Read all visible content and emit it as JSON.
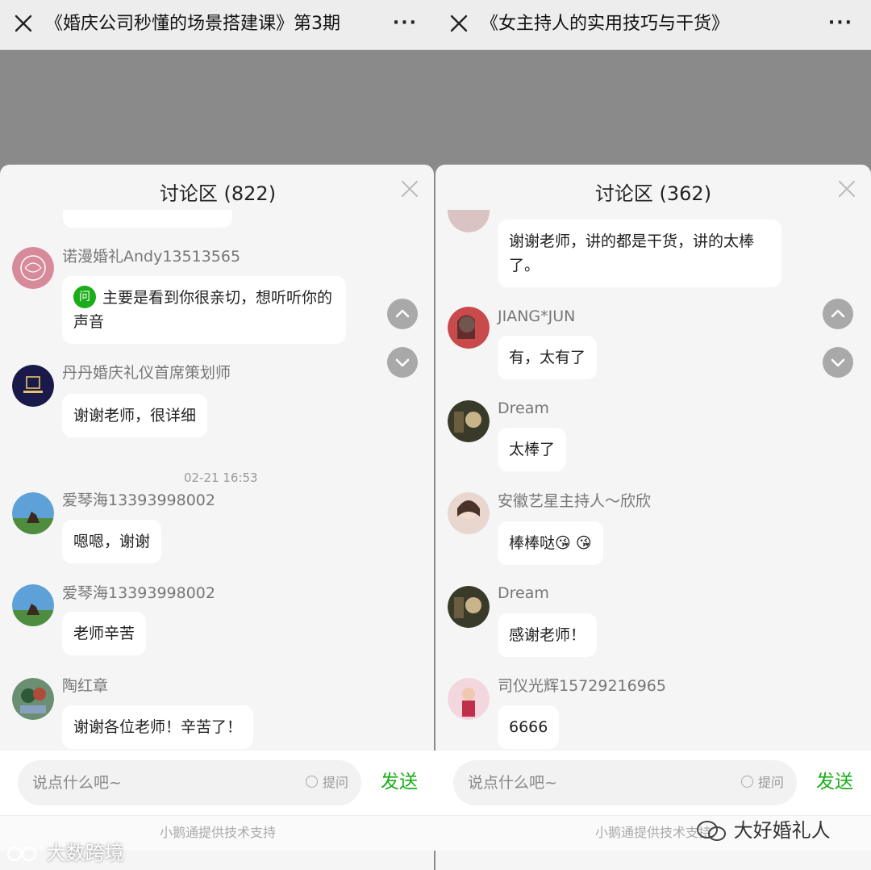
{
  "left": {
    "title": "《婚庆公司秒懂的场景搭建课》第3期",
    "more": "···",
    "sheet_title": "讨论区 (822)",
    "input_placeholder": "说点什么吧~",
    "ask_label": "提问",
    "send_label": "发送",
    "footer": "小鹅通提供技术支持",
    "messages": [
      {
        "user": "诺漫婚礼Andy13513565",
        "tag": "问",
        "text": "主要是看到你很亲切，想听听你的声音"
      },
      {
        "user": "丹丹婚庆礼仪首席策划师",
        "text": "谢谢老师，很详细"
      },
      {
        "user": "爱琴海13393998002",
        "text": "嗯嗯，谢谢"
      },
      {
        "user": "爱琴海13393998002",
        "text": "老师辛苦"
      },
      {
        "user": "陶红章",
        "text": "谢谢各位老师！辛苦了！"
      }
    ],
    "timestamp": "02-21 16:53"
  },
  "right": {
    "title": "《女主持人的实用技巧与干货》",
    "more": "···",
    "sheet_title": "讨论区 (362)",
    "input_placeholder": "说点什么吧~",
    "ask_label": "提问",
    "send_label": "发送",
    "footer": "小鹅通提供技术支持",
    "messages": [
      {
        "user": "",
        "text": "谢谢老师，讲的都是干货，讲的太棒了。"
      },
      {
        "user": "JIANG*JUN",
        "text": "有，太有了"
      },
      {
        "user": "Dream",
        "text": "太棒了"
      },
      {
        "user": "安徽艺星主持人～欣欣",
        "text": "棒棒哒😘 😘"
      },
      {
        "user": "Dream",
        "text": "感谢老师！"
      },
      {
        "user": "司仪光辉15729216965",
        "text": "6666"
      }
    ]
  },
  "watermarks": {
    "bottom_left": "大数跨境",
    "bottom_right": "大好婚礼人"
  },
  "colors": {
    "accent_green": "#1aad19",
    "overlay_gray": "#8a8a8a",
    "sheet_bg": "#f5f5f5"
  }
}
